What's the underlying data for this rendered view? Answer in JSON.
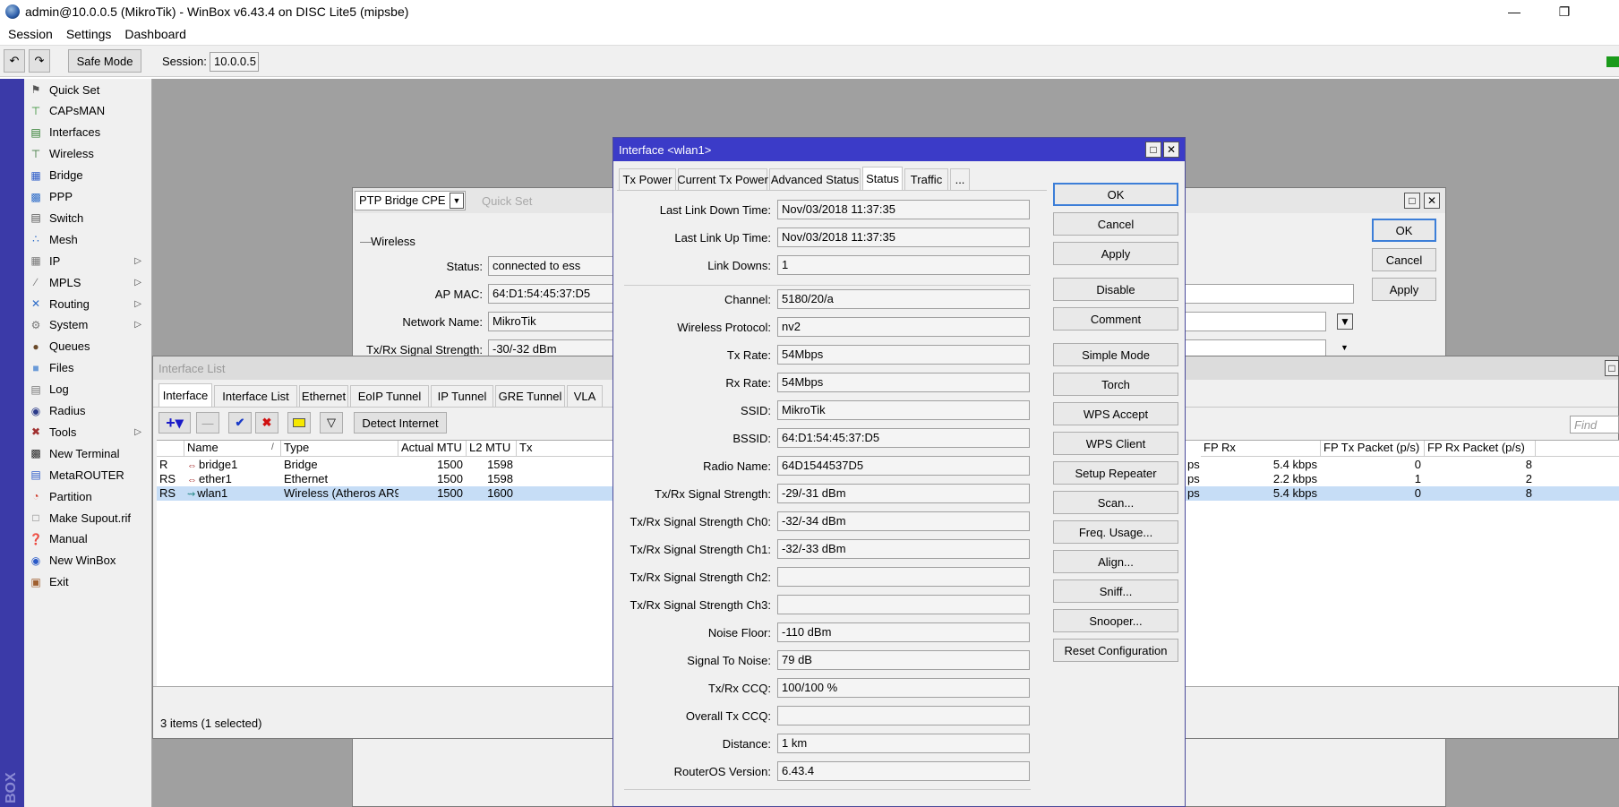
{
  "window": {
    "title": "admin@10.0.0.5 (MikroTik) - WinBox v6.43.4 on DISC Lite5 (mipsbe)"
  },
  "menu": [
    "Session",
    "Settings",
    "Dashboard"
  ],
  "toolbar": {
    "safe_mode": "Safe Mode",
    "session_label": "Session:",
    "session_value": "10.0.0.5"
  },
  "sidebar": {
    "brand": "BOX",
    "items": [
      {
        "label": "Quick Set",
        "icon": "quick-set-icon",
        "submenu": false
      },
      {
        "label": "CAPsMAN",
        "icon": "antenna-icon",
        "submenu": false
      },
      {
        "label": "Interfaces",
        "icon": "interfaces-icon",
        "submenu": false
      },
      {
        "label": "Wireless",
        "icon": "wireless-icon",
        "submenu": false
      },
      {
        "label": "Bridge",
        "icon": "bridge-icon",
        "submenu": false
      },
      {
        "label": "PPP",
        "icon": "ppp-icon",
        "submenu": false
      },
      {
        "label": "Switch",
        "icon": "switch-icon",
        "submenu": false
      },
      {
        "label": "Mesh",
        "icon": "mesh-icon",
        "submenu": false
      },
      {
        "label": "IP",
        "icon": "ip-icon",
        "submenu": true
      },
      {
        "label": "MPLS",
        "icon": "mpls-icon",
        "submenu": true
      },
      {
        "label": "Routing",
        "icon": "routing-icon",
        "submenu": true
      },
      {
        "label": "System",
        "icon": "gear-icon",
        "submenu": true
      },
      {
        "label": "Queues",
        "icon": "queues-icon",
        "submenu": false
      },
      {
        "label": "Files",
        "icon": "folder-icon",
        "submenu": false
      },
      {
        "label": "Log",
        "icon": "log-icon",
        "submenu": false
      },
      {
        "label": "Radius",
        "icon": "radius-icon",
        "submenu": false
      },
      {
        "label": "Tools",
        "icon": "tools-icon",
        "submenu": true
      },
      {
        "label": "New Terminal",
        "icon": "terminal-icon",
        "submenu": false
      },
      {
        "label": "MetaROUTER",
        "icon": "metarouter-icon",
        "submenu": false
      },
      {
        "label": "Partition",
        "icon": "partition-icon",
        "submenu": false
      },
      {
        "label": "Make Supout.rif",
        "icon": "document-icon",
        "submenu": false
      },
      {
        "label": "Manual",
        "icon": "help-icon",
        "submenu": false
      },
      {
        "label": "New WinBox",
        "icon": "winbox-icon",
        "submenu": false
      },
      {
        "label": "Exit",
        "icon": "exit-icon",
        "submenu": false
      }
    ]
  },
  "quickset": {
    "mode": "PTP Bridge CPE",
    "title": "Quick Set",
    "section": "Wireless",
    "fields": [
      {
        "label": "Status:",
        "value": "connected to ess"
      },
      {
        "label": "AP MAC:",
        "value": "64:D1:54:45:37:D5"
      },
      {
        "label": "Network Name:",
        "value": "MikroTik"
      },
      {
        "label": "Tx/Rx Signal Strength:",
        "value": "-30/-32 dBm"
      }
    ],
    "buttons": [
      "OK",
      "Cancel",
      "Apply"
    ]
  },
  "iflist": {
    "title": "Interface List",
    "tabs": [
      "Interface",
      "Interface List",
      "Ethernet",
      "EoIP Tunnel",
      "IP Tunnel",
      "GRE Tunnel",
      "VLA"
    ],
    "detect": "Detect Internet",
    "find_placeholder": "Find",
    "columns": [
      "Name",
      "Type",
      "Actual MTU",
      "L2 MTU",
      "Tx"
    ],
    "right_columns": [
      "FP Rx",
      "FP Tx Packet (p/s)",
      "FP Rx Packet (p/s)"
    ],
    "rows": [
      {
        "flags": "R",
        "name": "bridge1",
        "type": "Bridge",
        "mtu": "1500",
        "l2mtu": "1598",
        "tx_tail": "ps",
        "fprx": "5.4 kbps",
        "fptxp": "0",
        "fprxp": "8"
      },
      {
        "flags": "RS",
        "name": "ether1",
        "type": "Ethernet",
        "mtu": "1500",
        "l2mtu": "1598",
        "tx_tail": "ps",
        "fprx": "2.2 kbps",
        "fptxp": "1",
        "fprxp": "2"
      },
      {
        "flags": "RS",
        "name": "wlan1",
        "type": "Wireless (Atheros AR9...",
        "mtu": "1500",
        "l2mtu": "1600",
        "tx_tail": "ps",
        "fprx": "5.4 kbps",
        "fptxp": "0",
        "fprxp": "8"
      }
    ],
    "status": "3 items (1 selected)"
  },
  "wlan": {
    "title": "Interface <wlan1>",
    "tabs": [
      "Tx Power",
      "Current Tx Power",
      "Advanced Status",
      "Status",
      "Traffic",
      "..."
    ],
    "fields": [
      {
        "label": "Last Link Down Time:",
        "value": "Nov/03/2018 11:37:35"
      },
      {
        "label": "Last Link Up Time:",
        "value": "Nov/03/2018 11:37:35"
      },
      {
        "label": "Link Downs:",
        "value": "1"
      },
      {
        "label": "Channel:",
        "value": "5180/20/a"
      },
      {
        "label": "Wireless Protocol:",
        "value": "nv2"
      },
      {
        "label": "Tx Rate:",
        "value": "54Mbps"
      },
      {
        "label": "Rx Rate:",
        "value": "54Mbps"
      },
      {
        "label": "SSID:",
        "value": "MikroTik"
      },
      {
        "label": "BSSID:",
        "value": "64:D1:54:45:37:D5"
      },
      {
        "label": "Radio Name:",
        "value": "64D1544537D5"
      },
      {
        "label": "Tx/Rx Signal Strength:",
        "value": "-29/-31 dBm"
      },
      {
        "label": "Tx/Rx Signal Strength Ch0:",
        "value": "-32/-34 dBm"
      },
      {
        "label": "Tx/Rx Signal Strength Ch1:",
        "value": "-32/-33 dBm"
      },
      {
        "label": "Tx/Rx Signal Strength Ch2:",
        "value": ""
      },
      {
        "label": "Tx/Rx Signal Strength Ch3:",
        "value": ""
      },
      {
        "label": "Noise Floor:",
        "value": "-110 dBm"
      },
      {
        "label": "Signal To Noise:",
        "value": "79 dB"
      },
      {
        "label": "Tx/Rx CCQ:",
        "value": "100/100 %"
      },
      {
        "label": "Overall Tx CCQ:",
        "value": ""
      },
      {
        "label": "Distance:",
        "value": "1 km"
      },
      {
        "label": "RouterOS Version:",
        "value": "6.43.4"
      }
    ],
    "buttons": [
      "OK",
      "Cancel",
      "Apply",
      "Disable",
      "Comment",
      "Simple Mode",
      "Torch",
      "WPS Accept",
      "WPS Client",
      "Setup Repeater",
      "Scan...",
      "Freq. Usage...",
      "Align...",
      "Sniff...",
      "Snooper...",
      "Reset Configuration"
    ]
  }
}
